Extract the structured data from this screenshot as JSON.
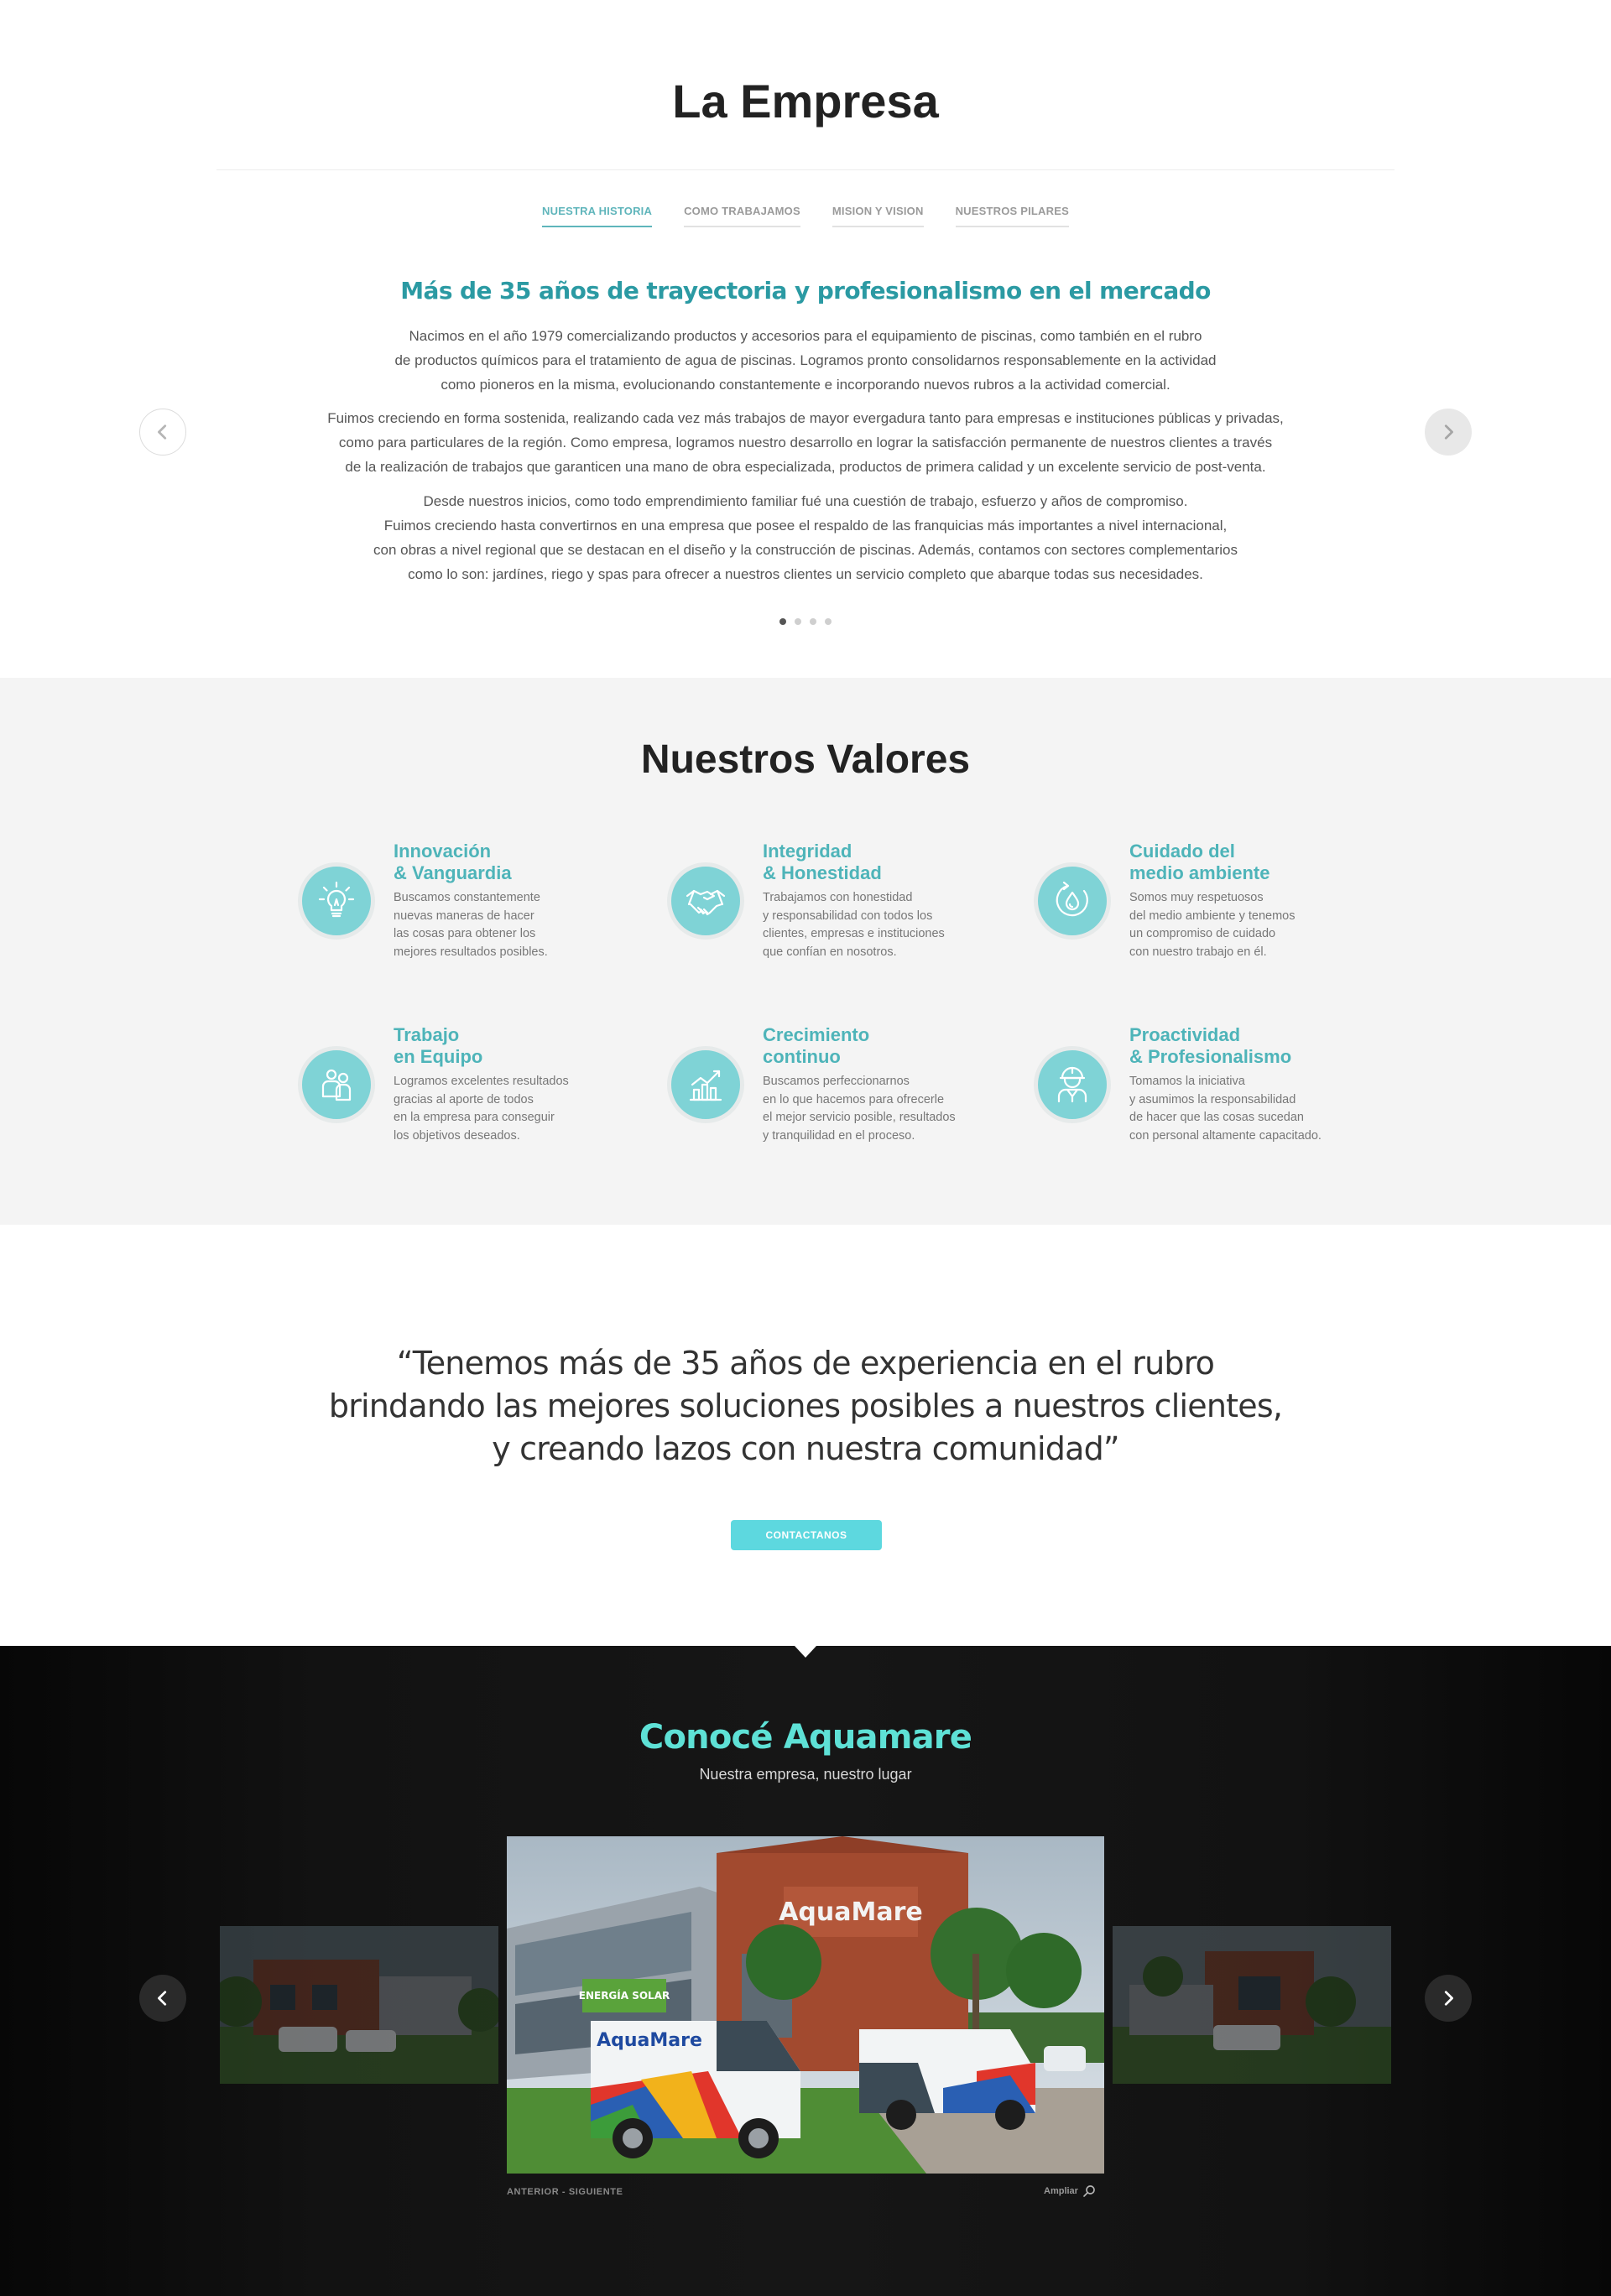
{
  "empresa": {
    "title": "La Empresa",
    "tabs": [
      {
        "label": "NUESTRA HISTORIA",
        "active": true
      },
      {
        "label": "COMO TRABAJAMOS",
        "active": false
      },
      {
        "label": "MISION Y VISION",
        "active": false
      },
      {
        "label": "NUESTROS PILARES",
        "active": false
      }
    ],
    "subtitle": "Más de 35 años de trayectoria y profesionalismo en el mercado",
    "paragraphs": [
      [
        "Nacimos en el año 1979 comercializando productos y accesorios para el equipamiento de piscinas, como también en el rubro",
        "de productos químicos para el tratamiento de agua de piscinas. Logramos pronto consolidarnos responsablemente en la actividad",
        "como pioneros en la misma, evolucionando constantemente e incorporando nuevos rubros a la actividad comercial."
      ],
      [
        "Fuimos creciendo en forma sostenida, realizando cada vez más trabajos de mayor evergadura tanto para empresas e instituciones públicas y privadas,",
        "como para particulares de la región. Como empresa, logramos nuestro desarrollo en lograr la satisfacción permanente de nuestros clientes a través",
        "de la realización de trabajos que garanticen una mano de obra especializada, productos de primera calidad y un excelente servicio de post-venta."
      ],
      [
        "Desde nuestros inicios, como todo emprendimiento familiar fué una cuestión de trabajo, esfuerzo y años de compromiso.",
        "Fuimos creciendo hasta convertirnos en una empresa que posee el respaldo de las franquicias más importantes a nivel internacional,",
        "con obras a nivel regional que se destacan en el diseño y la construcción de piscinas. Además, contamos con sectores complementarios",
        "como lo son: jardínes, riego y spas para ofrecer a nuestros clientes un servicio completo que abarque todas sus necesidades."
      ]
    ],
    "slide_count": 4,
    "active_slide": 1
  },
  "valores": {
    "title": "Nuestros Valores",
    "items": [
      {
        "icon": "lightbulb-icon",
        "title": [
          "Innovación",
          "& Vanguardia"
        ],
        "desc": [
          "Buscamos constantemente",
          "nuevas maneras de hacer",
          "las cosas para obtener los",
          "mejores resultados posibles."
        ]
      },
      {
        "icon": "handshake-icon",
        "title": [
          "Integridad",
          "& Honestidad"
        ],
        "desc": [
          "Trabajamos con honestidad",
          "y responsabilidad con todos los",
          "clientes, empresas e instituciones",
          "que confían en nosotros."
        ]
      },
      {
        "icon": "water-drop-icon",
        "title": [
          "Cuidado del",
          "medio ambiente"
        ],
        "desc": [
          "Somos muy respetuosos",
          "del medio ambiente y tenemos",
          "un compromiso de cuidado",
          "con nuestro trabajo en él."
        ]
      },
      {
        "icon": "team-icon",
        "title": [
          "Trabajo",
          "en Equipo"
        ],
        "desc": [
          "Logramos excelentes resultados",
          "gracias al aporte de todos",
          "en la empresa para conseguir",
          "los objetivos deseados."
        ]
      },
      {
        "icon": "growth-chart-icon",
        "title": [
          "Crecimiento",
          "continuo"
        ],
        "desc": [
          "Buscamos perfeccionarnos",
          "en lo que hacemos para ofrecerle",
          "el mejor servicio posible, resultados",
          "y tranquilidad en el proceso."
        ]
      },
      {
        "icon": "worker-icon",
        "title": [
          "Proactividad",
          "& Profesionalismo"
        ],
        "desc": [
          "Tomamos la iniciativa",
          "y asumimos la responsabilidad",
          "de hacer que las cosas sucedan",
          "con personal altamente capacitado."
        ]
      }
    ]
  },
  "quote": {
    "lines": [
      "“Tenemos más de 35 años de experiencia en el rubro",
      "brindando las mejores soluciones posibles a nuestros clientes,",
      "y creando lazos con nuestra comunidad”"
    ],
    "button_label": "CONTACTANOS"
  },
  "conoce": {
    "title": "Conocé Aquamare",
    "subtitle": "Nuestra empresa, nuestro lugar",
    "building_sign": "AquaMare",
    "van_brand": "AquaMare",
    "store_sign": "ENERGÍA SOLAR",
    "nav_text": "ANTERIOR - SIGUIENTE",
    "zoom_label": "Ampliar"
  },
  "colors": {
    "accent": "#5fb5bb",
    "subtitle_teal": "#2b9aa3",
    "icon_bg": "#7fd3d6",
    "button": "#5dd8df",
    "conoce_title": "#5ee1d6"
  }
}
